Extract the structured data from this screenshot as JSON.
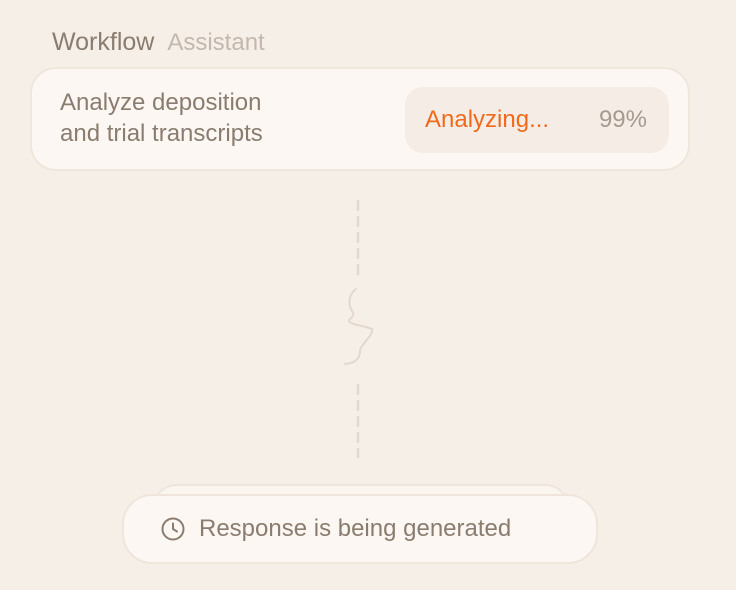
{
  "header": {
    "primary_label": "Workflow",
    "secondary_label": "Assistant"
  },
  "task": {
    "title_line1": "Analyze deposition",
    "title_line2": "and trial transcripts",
    "status": "Analyzing...",
    "progress": "99%"
  },
  "footer": {
    "message": "Response is being generated",
    "icon": "clock-icon"
  },
  "colors": {
    "background": "#f6efe8",
    "accent": "#ef6a1d",
    "text": "#8a7d70",
    "muted_text": "#c3b8ad"
  }
}
